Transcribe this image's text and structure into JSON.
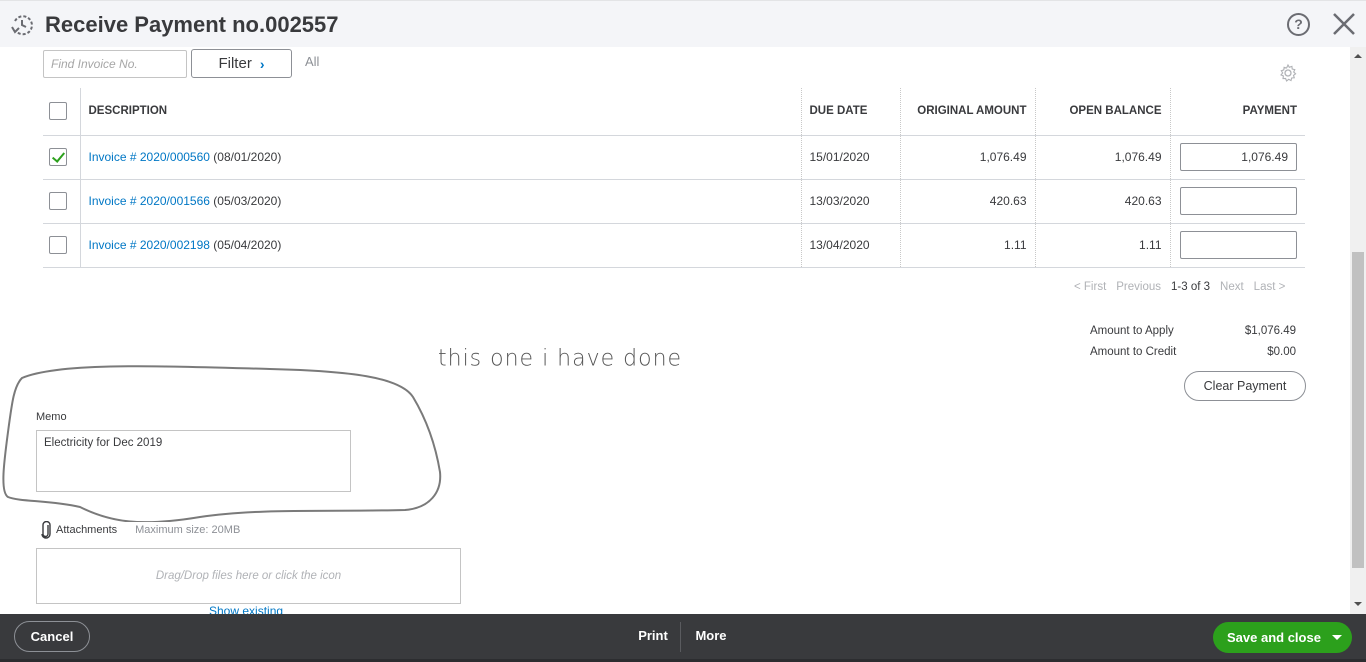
{
  "header": {
    "title": "Receive Payment no.002557",
    "icons": {
      "history": "history-clock-icon",
      "help": "help-icon",
      "close": "close-icon"
    },
    "help_glyph": "?"
  },
  "filters": {
    "find_placeholder": "Find Invoice No.",
    "find_value": "",
    "filter_label": "Filter",
    "filter_chevron": "›",
    "scope_label": "All"
  },
  "table": {
    "columns": [
      "DESCRIPTION",
      "DUE DATE",
      "ORIGINAL AMOUNT",
      "OPEN BALANCE",
      "PAYMENT"
    ],
    "select_all_checked": false,
    "rows": [
      {
        "checked": true,
        "invoice_link": "Invoice # 2020/000560",
        "invoice_date": "(08/01/2020)",
        "due_date": "15/01/2020",
        "original_amount": "1,076.49",
        "open_balance": "1,076.49",
        "payment": "1,076.49"
      },
      {
        "checked": false,
        "invoice_link": "Invoice # 2020/001566",
        "invoice_date": "(05/03/2020)",
        "due_date": "13/03/2020",
        "original_amount": "420.63",
        "open_balance": "420.63",
        "payment": ""
      },
      {
        "checked": false,
        "invoice_link": "Invoice # 2020/002198",
        "invoice_date": "(05/04/2020)",
        "due_date": "13/04/2020",
        "original_amount": "1.11",
        "open_balance": "1.11",
        "payment": ""
      }
    ]
  },
  "pagination": {
    "first": "< First",
    "previous": "Previous",
    "count": "1-3 of 3",
    "next": "Next",
    "last": "Last >"
  },
  "summary": {
    "amount_to_apply_label": "Amount to Apply",
    "amount_to_apply": "$1,076.49",
    "amount_to_credit_label": "Amount to Credit",
    "amount_to_credit": "$0.00",
    "clear_payment_label": "Clear Payment"
  },
  "memo": {
    "label": "Memo",
    "value": "Electricity for Dec 2019"
  },
  "attachments": {
    "label": "Attachments",
    "max_size": "Maximum size: 20MB",
    "drop_text": "Drag/Drop files here or click the icon",
    "show_existing": "Show existing"
  },
  "annotation": {
    "handwritten_text": "this one i have done"
  },
  "footer": {
    "cancel_label": "Cancel",
    "print_label": "Print",
    "more_label": "More",
    "save_label": "Save and close"
  },
  "colors": {
    "accent_green": "#2ca01c",
    "link_blue": "#0077c5",
    "footer_bg": "#393a3d",
    "header_bg": "#f4f5f8"
  }
}
